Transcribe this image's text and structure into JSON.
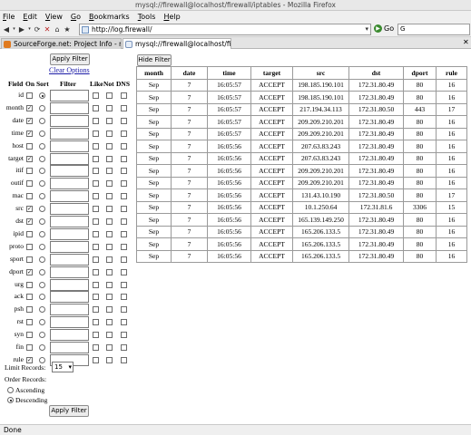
{
  "window_title": "mysql://firewall@localhost/firewall/iptables - Mozilla Firefox",
  "menu": [
    "File",
    "Edit",
    "View",
    "Go",
    "Bookmarks",
    "Tools",
    "Help"
  ],
  "url": "http://log.firewall/",
  "go_label": "Go",
  "search_placeholder": "G",
  "tabs": [
    {
      "label": "SourceForge.net: Project Info - readl...",
      "active": false
    },
    {
      "label": "mysql://firewall@localhost/firewa...",
      "active": true
    }
  ],
  "status": "Done",
  "filter_panel": {
    "apply_top": "Apply Filter",
    "clear": "Clear Options",
    "headers": {
      "field": "Field",
      "on": "On",
      "sort": "Sort",
      "filter": "Filter",
      "like": "Like",
      "not": "Not",
      "dns": "DNS"
    },
    "fields": [
      {
        "name": "id",
        "on": false,
        "sort": true
      },
      {
        "name": "month",
        "on": true,
        "sort": false
      },
      {
        "name": "date",
        "on": true,
        "sort": false
      },
      {
        "name": "time",
        "on": true,
        "sort": false
      },
      {
        "name": "host",
        "on": false,
        "sort": false
      },
      {
        "name": "target",
        "on": true,
        "sort": false
      },
      {
        "name": "itif",
        "on": false,
        "sort": false
      },
      {
        "name": "outif",
        "on": false,
        "sort": false
      },
      {
        "name": "mac",
        "on": false,
        "sort": false
      },
      {
        "name": "src",
        "on": true,
        "sort": false
      },
      {
        "name": "dst",
        "on": true,
        "sort": false
      },
      {
        "name": "ipid",
        "on": false,
        "sort": false
      },
      {
        "name": "proto",
        "on": false,
        "sort": false
      },
      {
        "name": "sport",
        "on": false,
        "sort": false
      },
      {
        "name": "dport",
        "on": true,
        "sort": false
      },
      {
        "name": "urg",
        "on": false,
        "sort": false
      },
      {
        "name": "ack",
        "on": false,
        "sort": false
      },
      {
        "name": "psh",
        "on": false,
        "sort": false
      },
      {
        "name": "rst",
        "on": false,
        "sort": false
      },
      {
        "name": "syn",
        "on": false,
        "sort": false
      },
      {
        "name": "fin",
        "on": false,
        "sort": false
      },
      {
        "name": "rule",
        "on": true,
        "sort": false
      }
    ],
    "limit_label": "Limit Records:",
    "limit_value": "15",
    "order_label": "Order Records:",
    "order_options": [
      {
        "label": "Ascending",
        "selected": false
      },
      {
        "label": "Descending",
        "selected": true
      }
    ],
    "apply_bottom": "Apply Filter"
  },
  "hide_filter": "Hide Filter",
  "results": {
    "columns": [
      "month",
      "date",
      "time",
      "target",
      "src",
      "dst",
      "dport",
      "rule"
    ],
    "rows": [
      [
        "Sep",
        "7",
        "16:05:57",
        "ACCEPT",
        "198.185.190.101",
        "172.31.80.49",
        "80",
        "16"
      ],
      [
        "Sep",
        "7",
        "16:05:57",
        "ACCEPT",
        "198.185.190.101",
        "172.31.80.49",
        "80",
        "16"
      ],
      [
        "Sep",
        "7",
        "16:05:57",
        "ACCEPT",
        "217.194.34.113",
        "172.31.80.50",
        "443",
        "17"
      ],
      [
        "Sep",
        "7",
        "16:05:57",
        "ACCEPT",
        "209.209.210.201",
        "172.31.80.49",
        "80",
        "16"
      ],
      [
        "Sep",
        "7",
        "16:05:57",
        "ACCEPT",
        "209.209.210.201",
        "172.31.80.49",
        "80",
        "16"
      ],
      [
        "Sep",
        "7",
        "16:05:56",
        "ACCEPT",
        "207.63.83.243",
        "172.31.80.49",
        "80",
        "16"
      ],
      [
        "Sep",
        "7",
        "16:05:56",
        "ACCEPT",
        "207.63.83.243",
        "172.31.80.49",
        "80",
        "16"
      ],
      [
        "Sep",
        "7",
        "16:05:56",
        "ACCEPT",
        "209.209.210.201",
        "172.31.80.49",
        "80",
        "16"
      ],
      [
        "Sep",
        "7",
        "16:05:56",
        "ACCEPT",
        "209.209.210.201",
        "172.31.80.49",
        "80",
        "16"
      ],
      [
        "Sep",
        "7",
        "16:05:56",
        "ACCEPT",
        "131.43.10.190",
        "172.31.80.50",
        "80",
        "17"
      ],
      [
        "Sep",
        "7",
        "16:05:56",
        "ACCEPT",
        "10.1.250.64",
        "172.31.81.6",
        "3306",
        "15"
      ],
      [
        "Sep",
        "7",
        "16:05:56",
        "ACCEPT",
        "165.139.149.250",
        "172.31.80.49",
        "80",
        "16"
      ],
      [
        "Sep",
        "7",
        "16:05:56",
        "ACCEPT",
        "165.206.133.5",
        "172.31.80.49",
        "80",
        "16"
      ],
      [
        "Sep",
        "7",
        "16:05:56",
        "ACCEPT",
        "165.206.133.5",
        "172.31.80.49",
        "80",
        "16"
      ],
      [
        "Sep",
        "7",
        "16:05:56",
        "ACCEPT",
        "165.206.133.5",
        "172.31.80.49",
        "80",
        "16"
      ]
    ]
  }
}
